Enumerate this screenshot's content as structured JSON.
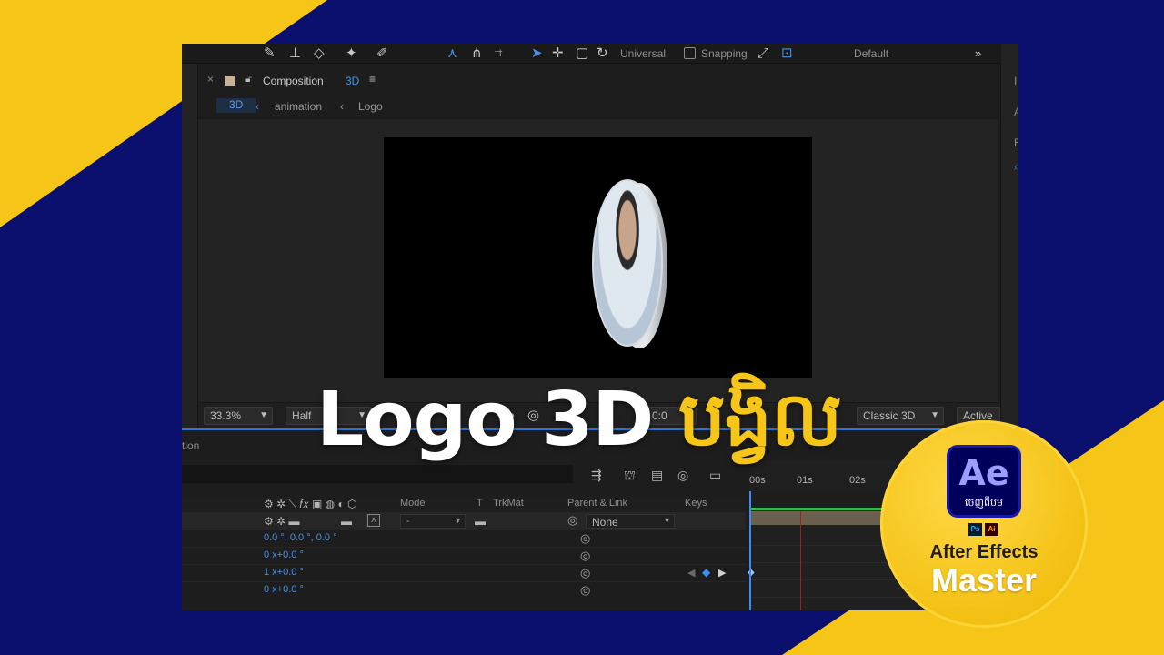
{
  "toolbar": {
    "universal_label": "Universal",
    "snapping_label": "Snapping",
    "workspace_label": "Default",
    "expand_glyph": "»"
  },
  "composition": {
    "panel_title": "Composition",
    "comp_tag": "3D",
    "breadcrumbs": [
      "3D",
      "animation",
      "Logo"
    ]
  },
  "viewer_controls": {
    "zoom": "33.3%",
    "resolution": "Half",
    "timecode_partial": "0:0",
    "renderer": "Classic 3D",
    "camera": "Active"
  },
  "timeline": {
    "panel_label_partial": "tion",
    "ruler_ticks": [
      "00s",
      "01s",
      "02s"
    ],
    "columns": {
      "mode": "Mode",
      "t": "T",
      "trkmat": "TrkMat",
      "parent": "Parent & Link",
      "keys": "Keys"
    },
    "layer": {
      "mode_value": "-",
      "parent_value": "None"
    },
    "properties": [
      {
        "value": "0.0 °, 0.0 °, 0.0 °"
      },
      {
        "value": "0 x+0.0 °"
      },
      {
        "value": "1 x+0.0 °"
      },
      {
        "value": "0 x+0.0 °"
      }
    ]
  },
  "overlay": {
    "title_latin": "Logo 3D",
    "title_khmer": "បង្វិល"
  },
  "badge": {
    "app_abbrev": "Ae",
    "app_sub": "ចេញពីបម",
    "ps": "Ps",
    "ai": "Ai",
    "line1": "After Effects",
    "line2": "Master"
  },
  "colors": {
    "background_navy": "#0b0f6e",
    "accent_yellow": "#f5c518",
    "ae_blue": "#4a8fe6"
  }
}
